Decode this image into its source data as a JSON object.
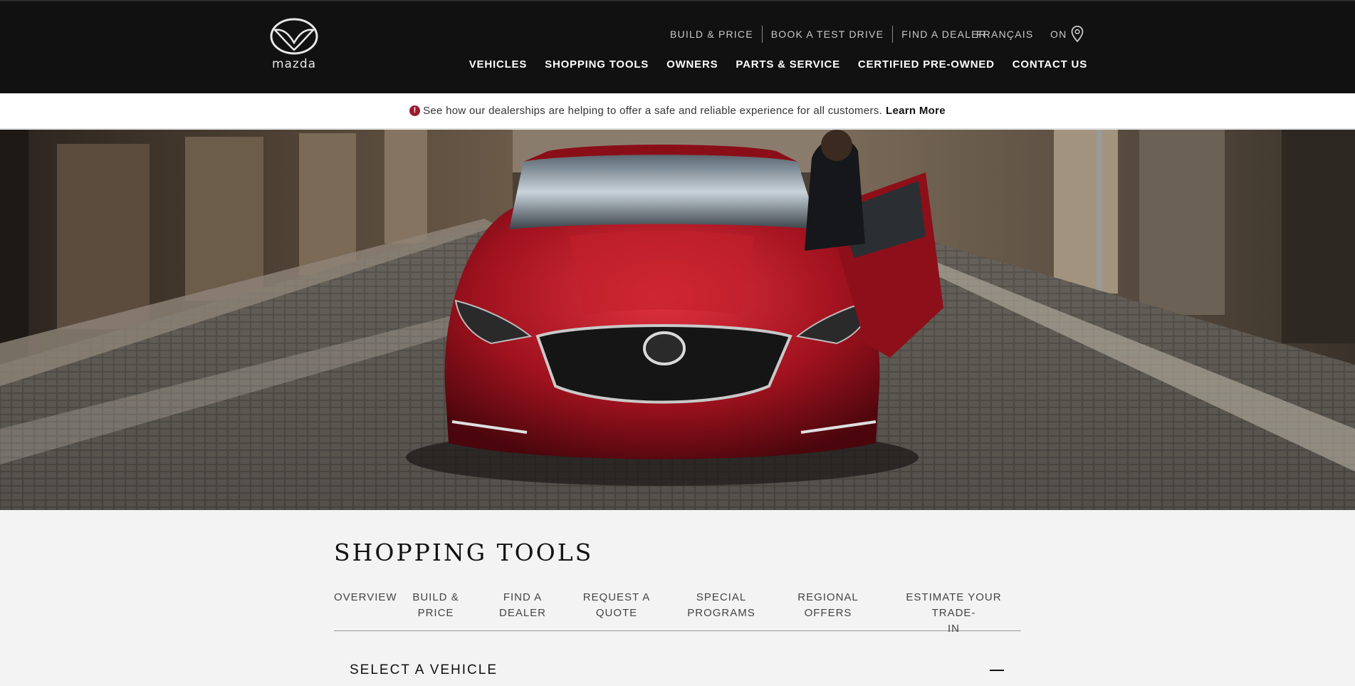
{
  "header": {
    "logo_text": "mazda",
    "utility_links": [
      "BUILD & PRICE",
      "BOOK A TEST DRIVE",
      "FIND A DEALER"
    ],
    "language_label": "FRANÇAIS",
    "region_label": "ON",
    "main_nav": [
      "VEHICLES",
      "SHOPPING TOOLS",
      "OWNERS",
      "PARTS & SERVICE",
      "CERTIFIED PRE-OWNED",
      "CONTACT US"
    ]
  },
  "alert": {
    "icon": "exclamation-icon",
    "message": "See how our dealerships are helping to offer a safe and reliable experience for all customers.",
    "link_label": "Learn More",
    "icon_color": "#9b1b30"
  },
  "hero": {
    "image": "red Mazda sedan front view in cobblestone street"
  },
  "section": {
    "title": "SHOPPING TOOLS",
    "tabs": [
      {
        "label_1": "OVERVIEW",
        "label_2": ""
      },
      {
        "label_1": "BUILD &",
        "label_2": "PRICE"
      },
      {
        "label_1": "FIND A",
        "label_2": "DEALER"
      },
      {
        "label_1": "REQUEST A",
        "label_2": "QUOTE"
      },
      {
        "label_1": "SPECIAL",
        "label_2": "PROGRAMS"
      },
      {
        "label_1": "REGIONAL",
        "label_2": "OFFERS"
      },
      {
        "label_1": "ESTIMATE YOUR TRADE-",
        "label_2": "IN"
      }
    ],
    "select_vehicle_label": "SELECT A VEHICLE"
  },
  "colors": {
    "header_bg": "#111111",
    "page_bg": "#f3f3f3",
    "accent_red": "#9b1b30"
  }
}
